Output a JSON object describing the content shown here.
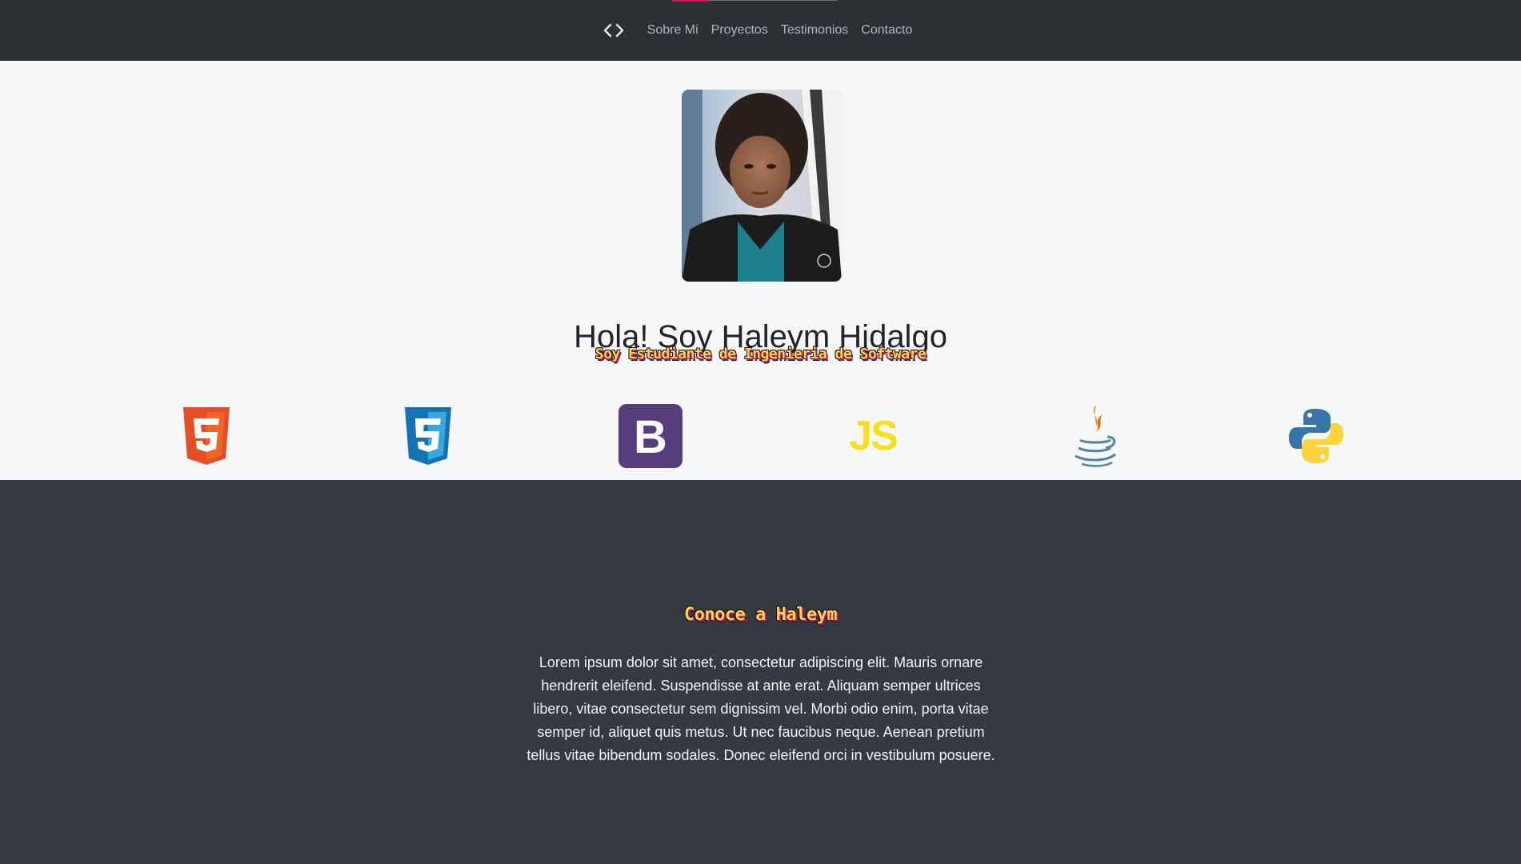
{
  "nav": {
    "brand_icon": "code-icon",
    "links": [
      "Sobre Mi",
      "Proyectos",
      "Testimonios",
      "Contacto"
    ],
    "accent_color": "#c2185b"
  },
  "hero": {
    "title": "Hola! Soy Haleym Hidalgo",
    "subtitle": "Soy Estudiante de Ingenieria de Software",
    "tech_icons": [
      "html5-icon",
      "css3-icon",
      "bootstrap-icon",
      "javascript-icon",
      "java-icon",
      "python-icon"
    ],
    "javascript_label": "JS"
  },
  "about": {
    "title": "Conoce a Haleym",
    "text": "Lorem ipsum dolor sit amet, consectetur adipiscing elit. Mauris ornare hendrerit eleifend. Suspendisse at ante erat. Aliquam semper ultrices libero, vitae consectetur sem dignissim vel. Morbi odio enim, porta vitae semper id, aliquet quis metus. Ut nec faucibus neque. Aenean pretium tellus vitae bibendum sodales. Donec eleifend orci in vestibulum posuere."
  },
  "colors": {
    "navbar_bg": "#2b3035",
    "hero_bg": "#f6f7f8",
    "about_bg": "#343a40",
    "title_gradient_yellow": "#fbd54a",
    "title_gradient_pink": "#b0196b"
  }
}
